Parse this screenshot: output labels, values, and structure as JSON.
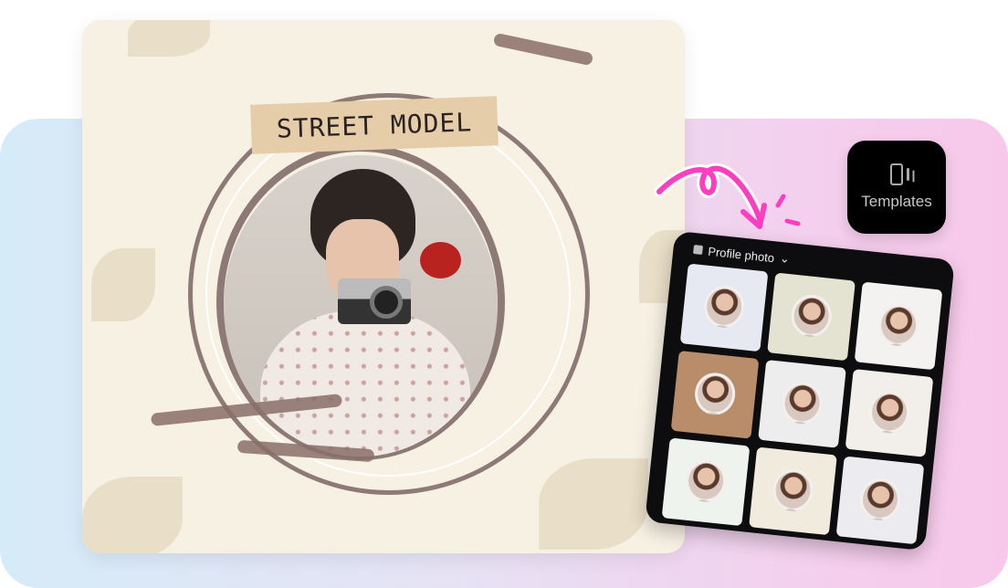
{
  "card": {
    "tape_label": "STREET MODEL"
  },
  "templates_button": {
    "label": "Templates",
    "icon": "templates-icon"
  },
  "panel": {
    "title": "Profile photo",
    "dropdown_icon": "chevron-down-icon",
    "thumbnails": [
      {
        "bg": "#e6e8f2"
      },
      {
        "bg": "#e4e3d2"
      },
      {
        "bg": "#f4f1f1"
      },
      {
        "bg": "#b98d6a"
      },
      {
        "bg": "#ededed"
      },
      {
        "bg": "#f2efea"
      },
      {
        "bg": "#eef3ee"
      },
      {
        "bg": "#f0ebdd"
      },
      {
        "bg": "#ececf0"
      }
    ]
  },
  "colors": {
    "accent": "#ff3fbf"
  }
}
